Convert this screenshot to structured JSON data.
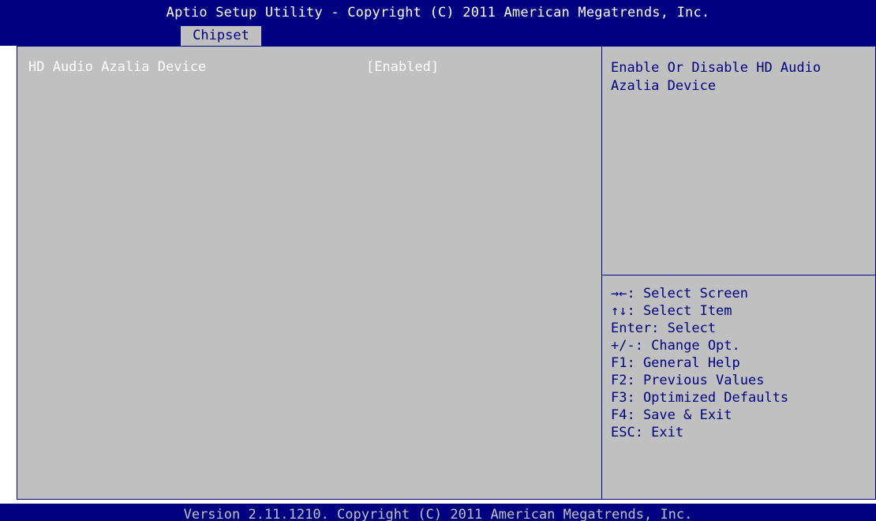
{
  "header": {
    "title": "Aptio Setup Utility - Copyright (C) 2011 American Megatrends, Inc.",
    "active_tab": "Chipset"
  },
  "settings": [
    {
      "name": "HD Audio Azalia Device",
      "value": "[Enabled]"
    }
  ],
  "help": {
    "description": "Enable Or Disable HD Audio\nAzalia Device"
  },
  "keys": [
    "→←: Select Screen",
    "↑↓: Select Item",
    "Enter: Select",
    "+/-: Change Opt.",
    "F1: General Help",
    "F2: Previous Values",
    "F3: Optimized Defaults",
    "F4: Save & Exit",
    "ESC: Exit"
  ],
  "footer": {
    "text": "Version 2.11.1210. Copyright (C) 2011 American Megatrends, Inc."
  },
  "colors": {
    "header_bg": "#000080",
    "panel_bg": "#c0c0c0",
    "selected_text": "#ffffff",
    "help_text": "#000080"
  }
}
